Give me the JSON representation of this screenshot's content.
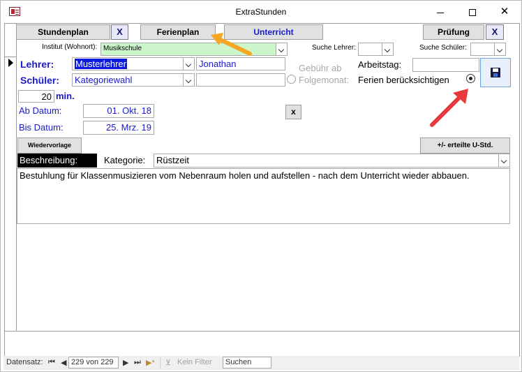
{
  "window": {
    "title": "ExtraStunden",
    "controls": {
      "minimize": "minimize",
      "maximize": "maximize",
      "close": "✕"
    }
  },
  "top_buttons": {
    "stundenplan": "Stundenplan",
    "x1": "X",
    "ferienplan": "Ferienplan",
    "unterricht": "Unterricht",
    "pruefung": "Prüfung",
    "x2": "X"
  },
  "filters": {
    "institut_label": "Institut (Wohnort):",
    "institut_value": "Musikschule",
    "suche_lehrer_label": "Suche Lehrer:",
    "suche_lehrer_value": "",
    "suche_schueler_label": "Suche Schüler:",
    "suche_schueler_value": ""
  },
  "record": {
    "lehrer_label": "Lehrer:",
    "lehrer_value": "Musterlehrer",
    "lehrer_vorname": "Jonathan",
    "schueler_label": "Schüler:",
    "schueler_value": "Kategoriewahl",
    "schueler_extra": "",
    "minuten_value": "20",
    "minuten_unit": "min.",
    "gebuehr_label_1": "Gebühr ab",
    "gebuehr_label_2": "Folgemonat:",
    "arbeitstag_label": "Arbeitstag:",
    "arbeitstag_value": "",
    "ferien_label": "Ferien berücksichtigen",
    "ferien_checked": true,
    "ab_datum_label": "Ab Datum:",
    "ab_datum_value": "01. Okt. 18",
    "bis_datum_label": "Bis Datum:",
    "bis_datum_value": "25. Mrz. 19",
    "clear_button": "x",
    "wiedervorlage_button": "Wiedervorlage",
    "erteilte_button": "+/- erteilte U-Std.",
    "beschreibung_label": "Beschreibung:",
    "kategorie_label": "Kategorie:",
    "kategorie_value": "Rüstzeit",
    "beschreibung_text": "Bestuhlung für Klassenmusizieren vom Nebenraum holen und aufstellen - nach dem Unterricht wieder abbauen."
  },
  "navigation": {
    "label": "Datensatz:",
    "first": "⏮",
    "prev": "◀",
    "position": "229 von 229",
    "next": "▶",
    "last": "⏭",
    "new": "▶*",
    "filter_label": "Kein Filter",
    "search_value": "Suchen"
  },
  "colors": {
    "highlight": "#0a1ae0",
    "label_blue": "#1a1acc",
    "arrow_orange": "#f5a623",
    "arrow_red": "#e8393d",
    "institut_bg": "#ccf5cc"
  },
  "icons": {
    "save": "save-icon",
    "app": "access-form-icon"
  }
}
